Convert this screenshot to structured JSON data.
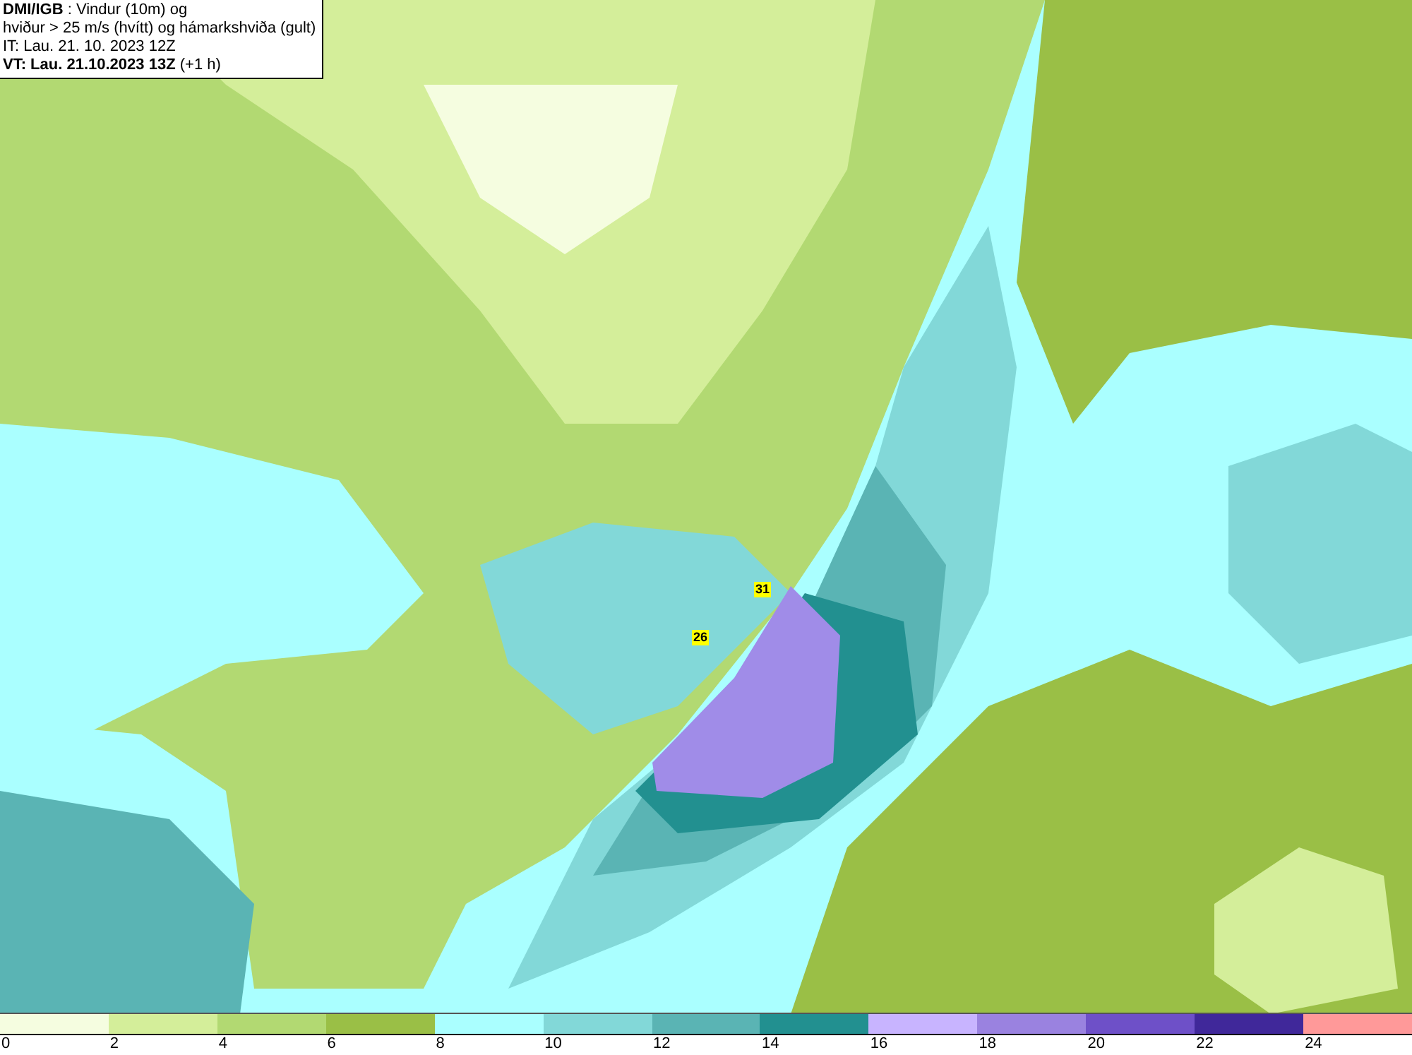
{
  "title_box": {
    "lines": [
      "**DMI/IGB** : Vindur (10m) og",
      "hviður > 25 m/s (hvítt) og hámarkshviða (gult)",
      "IT: Lau. 21. 10. 2023 12Z",
      "**VT: Lau. 21.10.2023 13Z** (+1 h)"
    ]
  },
  "map": {
    "gust_labels": [
      "31",
      "26"
    ]
  },
  "legend": {
    "swatches": [
      {
        "color": "#f5fde0"
      },
      {
        "color": "#d4ee9a"
      },
      {
        "color": "#b2d972"
      },
      {
        "color": "#9abf46"
      },
      {
        "color": "#aaffff"
      },
      {
        "color": "#82d8d8"
      },
      {
        "color": "#5ab4b4"
      },
      {
        "color": "#229090"
      },
      {
        "color": "#c8b4ff"
      },
      {
        "color": "#9a82e0"
      },
      {
        "color": "#6e50c8"
      },
      {
        "color": "#40289a"
      },
      {
        "color": "#ff9999"
      }
    ],
    "ticks": [
      "0",
      "2",
      "4",
      "6",
      "8",
      "10",
      "12",
      "14",
      "16",
      "18",
      "20",
      "22",
      "24"
    ]
  }
}
